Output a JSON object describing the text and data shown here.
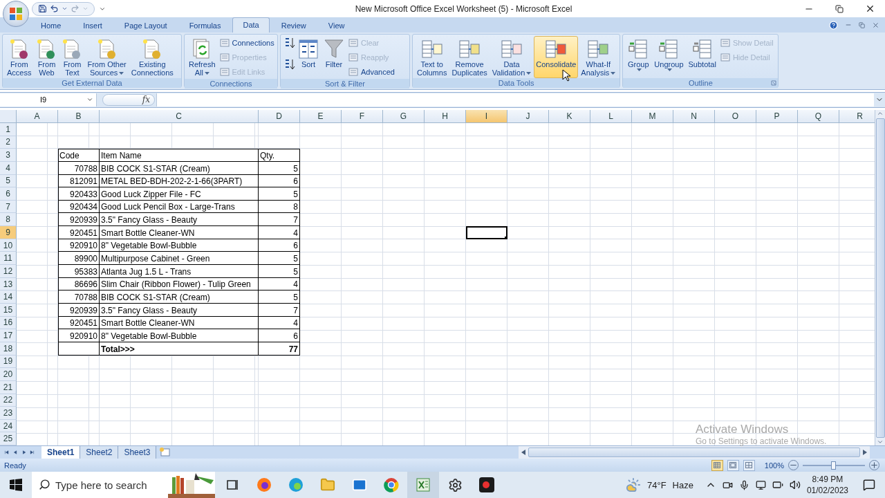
{
  "window": {
    "title": "New Microsoft Office Excel Worksheet (5) - Microsoft Excel"
  },
  "tabs": [
    {
      "label": "Home",
      "selected": false
    },
    {
      "label": "Insert",
      "selected": false
    },
    {
      "label": "Page Layout",
      "selected": false
    },
    {
      "label": "Formulas",
      "selected": false
    },
    {
      "label": "Data",
      "selected": true
    },
    {
      "label": "Review",
      "selected": false
    },
    {
      "label": "View",
      "selected": false
    }
  ],
  "ribbon_groups": [
    {
      "label": "Get External Data",
      "launcher": false,
      "items": [
        {
          "kind": "large",
          "label": "From\nAccess",
          "dropdown": false,
          "hovered": false
        },
        {
          "kind": "large",
          "label": "From\nWeb",
          "dropdown": false,
          "hovered": false
        },
        {
          "kind": "large",
          "label": "From\nText",
          "dropdown": false,
          "hovered": false
        },
        {
          "kind": "large",
          "label": "From Other\nSources",
          "dropdown": true,
          "hovered": false
        },
        {
          "kind": "large",
          "label": "Existing\nConnections",
          "dropdown": false,
          "hovered": false
        }
      ]
    },
    {
      "label": "Connections",
      "launcher": false,
      "items": [
        {
          "kind": "large",
          "label": "Refresh\nAll",
          "dropdown": true,
          "hovered": false
        },
        {
          "kind": "stack",
          "items": [
            {
              "label": "Connections",
              "disabled": false
            },
            {
              "label": "Properties",
              "disabled": true
            },
            {
              "label": "Edit Links",
              "disabled": true
            }
          ]
        }
      ]
    },
    {
      "label": "Sort & Filter",
      "launcher": false,
      "items": [
        {
          "kind": "sort_icons"
        },
        {
          "kind": "large",
          "label": "Sort",
          "dropdown": false,
          "hovered": false
        },
        {
          "kind": "large",
          "label": "Filter",
          "dropdown": false,
          "hovered": false
        },
        {
          "kind": "stack",
          "items": [
            {
              "label": "Clear",
              "disabled": true
            },
            {
              "label": "Reapply",
              "disabled": true
            },
            {
              "label": "Advanced",
              "disabled": false
            }
          ]
        }
      ]
    },
    {
      "label": "Data Tools",
      "launcher": false,
      "items": [
        {
          "kind": "large",
          "label": "Text to\nColumns",
          "dropdown": false,
          "hovered": false
        },
        {
          "kind": "large",
          "label": "Remove\nDuplicates",
          "dropdown": false,
          "hovered": false
        },
        {
          "kind": "large",
          "label": "Data\nValidation",
          "dropdown": true,
          "hovered": false
        },
        {
          "kind": "large",
          "label": "Consolidate",
          "dropdown": false,
          "hovered": true
        },
        {
          "kind": "large",
          "label": "What-If\nAnalysis",
          "dropdown": true,
          "hovered": false
        }
      ]
    },
    {
      "label": "Outline",
      "launcher": true,
      "items": [
        {
          "kind": "large",
          "label": "Group",
          "dropdown": true,
          "hovered": false
        },
        {
          "kind": "large",
          "label": "Ungroup",
          "dropdown": true,
          "hovered": false
        },
        {
          "kind": "large",
          "label": "Subtotal",
          "dropdown": false,
          "hovered": false
        },
        {
          "kind": "stack",
          "items": [
            {
              "label": "Show Detail",
              "disabled": true
            },
            {
              "label": "Hide Detail",
              "disabled": true
            }
          ]
        }
      ]
    }
  ],
  "formula_bar": {
    "name_box": "I9",
    "function_label": "fx"
  },
  "sheet": {
    "columns": [
      {
        "label": "A",
        "selected": false
      },
      {
        "label": "B",
        "selected": false
      },
      {
        "label": "C",
        "selected": false
      },
      {
        "label": "D",
        "selected": false
      },
      {
        "label": "E",
        "selected": false
      },
      {
        "label": "F",
        "selected": false
      },
      {
        "label": "G",
        "selected": false
      },
      {
        "label": "H",
        "selected": false
      },
      {
        "label": "I",
        "selected": true
      },
      {
        "label": "J",
        "selected": false
      },
      {
        "label": "K",
        "selected": false
      },
      {
        "label": "L",
        "selected": false
      },
      {
        "label": "M",
        "selected": false
      },
      {
        "label": "N",
        "selected": false
      },
      {
        "label": "O",
        "selected": false
      },
      {
        "label": "P",
        "selected": false
      },
      {
        "label": "Q",
        "selected": false
      },
      {
        "label": "R",
        "selected": false
      }
    ],
    "rows": [
      {
        "label": "1",
        "selected": false
      },
      {
        "label": "2",
        "selected": false
      },
      {
        "label": "3",
        "selected": false
      },
      {
        "label": "4",
        "selected": false
      },
      {
        "label": "5",
        "selected": false
      },
      {
        "label": "6",
        "selected": false
      },
      {
        "label": "7",
        "selected": false
      },
      {
        "label": "8",
        "selected": false
      },
      {
        "label": "9",
        "selected": true
      },
      {
        "label": "10",
        "selected": false
      },
      {
        "label": "11",
        "selected": false
      },
      {
        "label": "12",
        "selected": false
      },
      {
        "label": "13",
        "selected": false
      },
      {
        "label": "14",
        "selected": false
      },
      {
        "label": "15",
        "selected": false
      },
      {
        "label": "16",
        "selected": false
      },
      {
        "label": "17",
        "selected": false
      },
      {
        "label": "18",
        "selected": false
      },
      {
        "label": "19",
        "selected": false
      },
      {
        "label": "20",
        "selected": false
      },
      {
        "label": "21",
        "selected": false
      },
      {
        "label": "22",
        "selected": false
      },
      {
        "label": "23",
        "selected": false
      },
      {
        "label": "24",
        "selected": false
      },
      {
        "label": "25",
        "selected": false
      }
    ]
  },
  "table": {
    "columns": [
      "Code",
      "Item Name",
      "Qty."
    ],
    "rows": [
      [
        "70788",
        "BIB COCK S1-STAR (Cream)",
        "5"
      ],
      [
        "812091",
        "METAL BED-BDH-202-2-1-66(3PART)",
        "6"
      ],
      [
        "920433",
        "Good Luck Zipper File - FC",
        "5"
      ],
      [
        "920434",
        "Good Luck Pencil Box - Large-Trans",
        "8"
      ],
      [
        "920939",
        "3.5\" Fancy Glass - Beauty",
        "7"
      ],
      [
        "920451",
        "Smart Bottle Cleaner-WN",
        "4"
      ],
      [
        "920910",
        "8\" Vegetable Bowl-Bubble",
        "6"
      ],
      [
        "89900",
        "Multipurpose Cabinet - Green",
        "5"
      ],
      [
        "95383",
        "Atlanta Jug 1.5 L - Trans",
        "5"
      ],
      [
        "86696",
        "Slim Chair (Ribbon Flower) - Tulip Green",
        "4"
      ],
      [
        "70788",
        "BIB COCK S1-STAR (Cream)",
        "5"
      ],
      [
        "920939",
        "3.5\" Fancy Glass - Beauty",
        "7"
      ],
      [
        "920451",
        "Smart Bottle Cleaner-WN",
        "4"
      ],
      [
        "920910",
        "8\" Vegetable Bowl-Bubble",
        "6"
      ]
    ],
    "total": {
      "label": "Total>>>",
      "value": "77"
    }
  },
  "sheet_tabs": [
    {
      "label": "Sheet1",
      "selected": true
    },
    {
      "label": "Sheet2",
      "selected": false
    },
    {
      "label": "Sheet3",
      "selected": false
    }
  ],
  "status_bar": {
    "status": "Ready",
    "view_buttons": [
      {
        "selected": true
      },
      {
        "selected": false
      },
      {
        "selected": false
      }
    ],
    "zoom": "100%",
    "zoom_slider": {
      "level": 0.5
    }
  },
  "activation_notice": {
    "title": "Activate Windows",
    "message": "Go to Settings to activate Windows."
  },
  "taskbar": {
    "search": {
      "placeholder": "Type here to search"
    },
    "weather": {
      "temperature": "74°F",
      "condition": "Haze"
    },
    "clock": {
      "time": "8:49 PM",
      "date": "01/02/2023"
    }
  }
}
